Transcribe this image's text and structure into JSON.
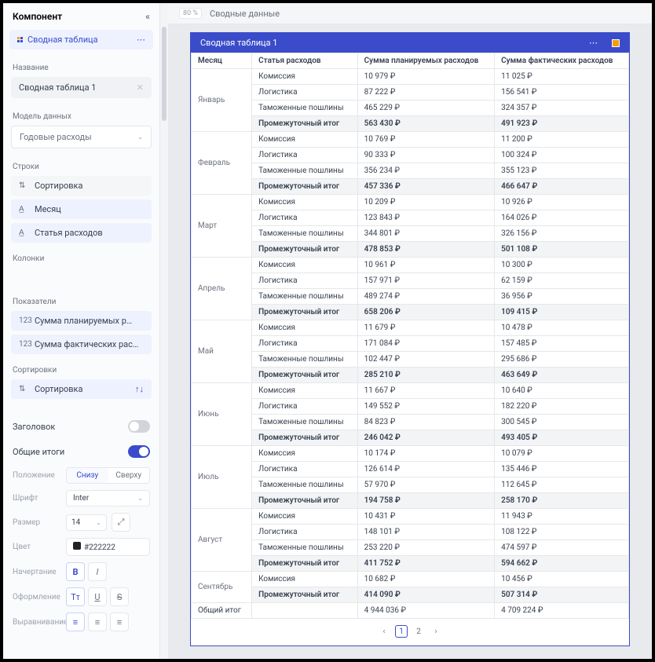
{
  "sidebar": {
    "title": "Компонент",
    "component_name": "Сводная таблица",
    "labels": {
      "name": "Название",
      "data_model": "Модель данных",
      "rows": "Строки",
      "columns": "Колонки",
      "measures": "Показатели",
      "sorting": "Сортировки",
      "header": "Заголовок",
      "grand_totals": "Общие итоги",
      "position": "Положение",
      "font": "Шрифт",
      "size": "Размер",
      "color": "Цвет",
      "style": "Начертание",
      "decoration": "Оформление",
      "alignment": "Выравнивание"
    },
    "name_value": "Сводная таблица 1",
    "data_model_value": "Годовые расходы",
    "rows_items": {
      "sort": "Сортировка",
      "month": "Месяц",
      "expense_item": "Статья расходов"
    },
    "measures_items": {
      "planned": "Сумма планируемых р…",
      "actual": "Сумма фактических рас…"
    },
    "sort_value": "Сортировка",
    "position_options": {
      "bottom": "Снизу",
      "top": "Сверху"
    },
    "font_value": "Inter",
    "size_value": "14",
    "color_value": "#222222"
  },
  "canvas": {
    "zoom": "80 %",
    "breadcrumb": "Сводные данные",
    "widget_title": "Сводная таблица 1",
    "headers": {
      "month": "Месяц",
      "expense": "Статья расходов",
      "planned": "Сумма планируемых расходов",
      "actual": "Сумма фактических расходов"
    },
    "subtotal_label": "Промежуточный итог",
    "grand_total_label": "Общий итог",
    "grand_total": {
      "planned": "4 944 036 ₽",
      "actual": "4 709 224 ₽"
    },
    "months": [
      {
        "name": "Январь",
        "rows": [
          [
            "Комиссия",
            "10 979 ₽",
            "11 025 ₽"
          ],
          [
            "Логистика",
            "87 222 ₽",
            "156 541 ₽"
          ],
          [
            "Таможенные пошлины",
            "465 229 ₽",
            "324 357 ₽"
          ]
        ],
        "sub": [
          "563 430 ₽",
          "491 923 ₽"
        ]
      },
      {
        "name": "Февраль",
        "rows": [
          [
            "Комиссия",
            "10 769 ₽",
            "11 200 ₽"
          ],
          [
            "Логистика",
            "90 333 ₽",
            "100 324 ₽"
          ],
          [
            "Таможенные пошлины",
            "356 234 ₽",
            "355 123 ₽"
          ]
        ],
        "sub": [
          "457 336 ₽",
          "466 647 ₽"
        ]
      },
      {
        "name": "Март",
        "rows": [
          [
            "Комиссия",
            "10 209 ₽",
            "10 926 ₽"
          ],
          [
            "Логистика",
            "123 843 ₽",
            "164 026 ₽"
          ],
          [
            "Таможенные пошлины",
            "344 801 ₽",
            "326 156 ₽"
          ]
        ],
        "sub": [
          "478 853 ₽",
          "501 108 ₽"
        ]
      },
      {
        "name": "Апрель",
        "rows": [
          [
            "Комиссия",
            "10 961 ₽",
            "10 300 ₽"
          ],
          [
            "Логистика",
            "157 971 ₽",
            "62 159 ₽"
          ],
          [
            "Таможенные пошлины",
            "489 274 ₽",
            "36 956 ₽"
          ]
        ],
        "sub": [
          "658 206 ₽",
          "109 415 ₽"
        ]
      },
      {
        "name": "Май",
        "rows": [
          [
            "Комиссия",
            "11 679 ₽",
            "10 478 ₽"
          ],
          [
            "Логистика",
            "171 084 ₽",
            "157 485 ₽"
          ],
          [
            "Таможенные пошлины",
            "102 447 ₽",
            "295 686 ₽"
          ]
        ],
        "sub": [
          "285 210 ₽",
          "463 649 ₽"
        ]
      },
      {
        "name": "Июнь",
        "rows": [
          [
            "Комиссия",
            "11 667 ₽",
            "10 640 ₽"
          ],
          [
            "Логистика",
            "149 552 ₽",
            "182 220 ₽"
          ],
          [
            "Таможенные пошлины",
            "84 823 ₽",
            "300 545 ₽"
          ]
        ],
        "sub": [
          "246 042 ₽",
          "493 405 ₽"
        ]
      },
      {
        "name": "Июль",
        "rows": [
          [
            "Комиссия",
            "10 174 ₽",
            "10 079 ₽"
          ],
          [
            "Логистика",
            "126 614 ₽",
            "135 446 ₽"
          ],
          [
            "Таможенные пошлины",
            "57 970 ₽",
            "112 645 ₽"
          ]
        ],
        "sub": [
          "194 758 ₽",
          "258 170 ₽"
        ]
      },
      {
        "name": "Август",
        "rows": [
          [
            "Комиссия",
            "10 431 ₽",
            "11 943 ₽"
          ],
          [
            "Логистика",
            "148 101 ₽",
            "108 122 ₽"
          ],
          [
            "Таможенные пошлины",
            "253 220 ₽",
            "474 597 ₽"
          ]
        ],
        "sub": [
          "411 752 ₽",
          "594 662 ₽"
        ]
      },
      {
        "name": "Сентябрь",
        "rows": [
          [
            "Комиссия",
            "10 682 ₽",
            "10 456 ₽"
          ]
        ],
        "sub": [
          "414 090 ₽",
          "507 314 ₽"
        ]
      }
    ],
    "pages": [
      "1",
      "2"
    ]
  }
}
